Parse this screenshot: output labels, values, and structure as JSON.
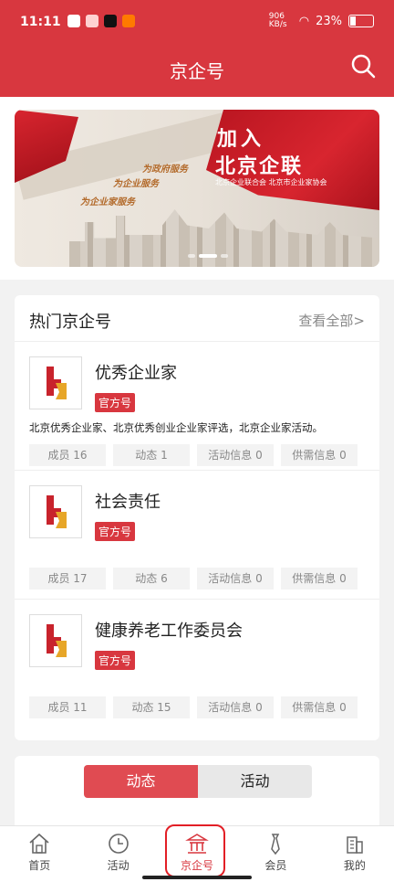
{
  "status": {
    "time": "11:11",
    "net": "906 KB/s",
    "battery": "23%"
  },
  "header": {
    "title": "京企号"
  },
  "banner": {
    "line1": "加入",
    "line2": "北京企联",
    "sub": "北京企业联合会  北京市企业家协会",
    "slogans": [
      "为政府服务",
      "为企业服务",
      "为企业家服务"
    ]
  },
  "hot": {
    "title": "热门京企号",
    "see_all": "查看全部>",
    "items": [
      {
        "name": "优秀企业家",
        "badge": "官方号",
        "desc": "北京优秀企业家、北京优秀创业企业家评选，北京企业家活动。",
        "stats": [
          "成员 16",
          "动态 1",
          "活动信息 0",
          "供需信息 0"
        ]
      },
      {
        "name": "社会责任",
        "badge": "官方号",
        "desc": "",
        "stats": [
          "成员 17",
          "动态 6",
          "活动信息 0",
          "供需信息 0"
        ]
      },
      {
        "name": "健康养老工作委员会",
        "badge": "官方号",
        "desc": "",
        "stats": [
          "成员 11",
          "动态 15",
          "活动信息 0",
          "供需信息 0"
        ]
      }
    ]
  },
  "segment": {
    "active": "动态",
    "inactive": "活动"
  },
  "tabbar": [
    {
      "label": "首页",
      "icon": "home-icon"
    },
    {
      "label": "活动",
      "icon": "clock-icon"
    },
    {
      "label": "京企号",
      "icon": "temple-icon"
    },
    {
      "label": "会员",
      "icon": "tie-icon"
    },
    {
      "label": "我的",
      "icon": "building-icon"
    }
  ],
  "colors": {
    "brand": "#d8373f",
    "tab_active": "#d8373f"
  }
}
